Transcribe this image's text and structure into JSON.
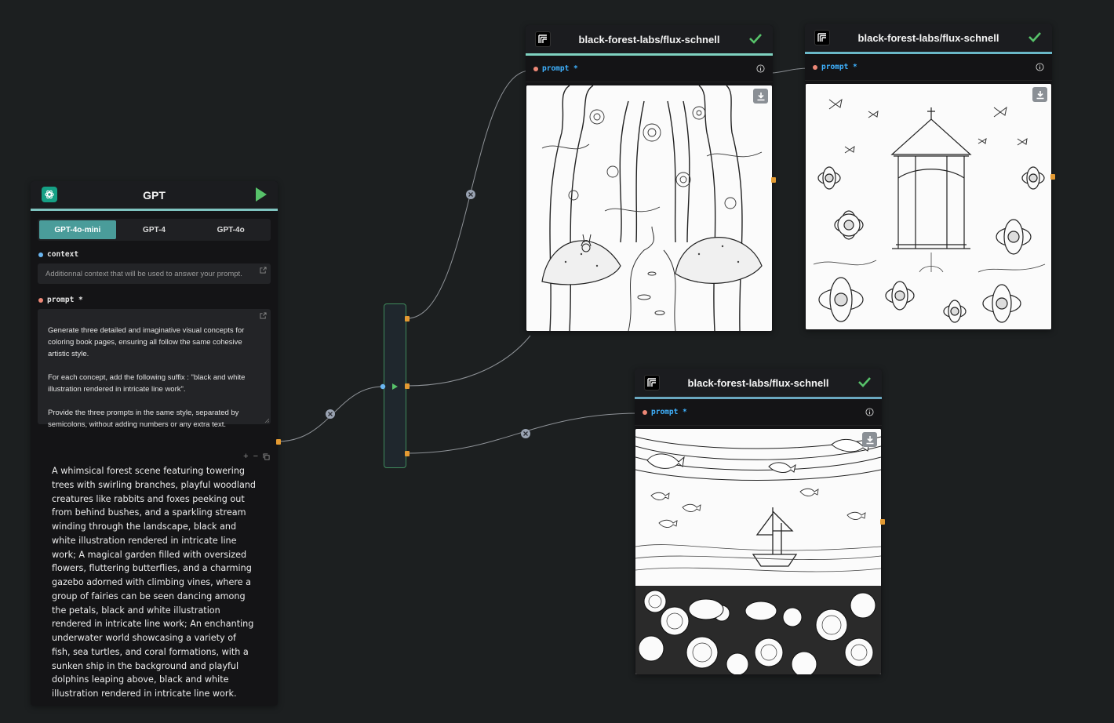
{
  "gpt_node": {
    "title": "GPT",
    "logo_icon": "openai-icon",
    "run_icon": "play-icon",
    "accent_color": "#7fc4c0",
    "models": [
      {
        "label": "GPT-4o-mini",
        "active": true
      },
      {
        "label": "GPT-4",
        "active": false
      },
      {
        "label": "GPT-4o",
        "active": false
      }
    ],
    "context": {
      "label": "context",
      "placeholder": "Additionnal context that will be used to answer your prompt."
    },
    "prompt": {
      "label": "prompt *",
      "value": "Generate three detailed and imaginative visual concepts for coloring book pages, ensuring all follow the same cohesive artistic style.\n\nFor each concept, add the following suffix : \"black and white illustration rendered in intricate line work\".\n\nProvide the three prompts in the same style, separated by semicolons, without adding numbers or any extra text."
    },
    "output_tools": {
      "plus": "+",
      "minus": "−",
      "copy_icon": "copy-icon"
    },
    "output": "A whimsical forest scene featuring towering trees with swirling branches, playful woodland creatures like rabbits and foxes peeking out from behind bushes, and a sparkling stream winding through the landscape, black and white illustration rendered in intricate line work; A magical garden filled with oversized flowers, fluttering butterflies, and a charming gazebo adorned with climbing vines, where a group of fairies can be seen dancing among the petals, black and white illustration rendered in intricate line work; An enchanting underwater world showcasing a variety of fish, sea turtles, and coral formations, with a sunken ship in the background and playful dolphins leaping above, black and white illustration rendered in intricate line work."
  },
  "splitter": {
    "border_color": "#3f8a5c"
  },
  "flux_nodes": [
    {
      "title": "black-forest-labs/flux-schnell",
      "prompt_label": "prompt *",
      "status_icon": "check-icon",
      "accent_color": "#7fd2c0",
      "image_subject": "forest"
    },
    {
      "title": "black-forest-labs/flux-schnell",
      "prompt_label": "prompt *",
      "status_icon": "check-icon",
      "accent_color": "#6ab8c8",
      "image_subject": "garden"
    },
    {
      "title": "black-forest-labs/flux-schnell",
      "prompt_label": "prompt *",
      "status_icon": "check-icon",
      "accent_color": "#6aa8c0",
      "image_subject": "underwater"
    }
  ],
  "colors": {
    "background": "#1c1f20",
    "node": "#141416",
    "port": "#e39a32",
    "success": "#57c26a",
    "prompt_label": "#3fb2ff"
  }
}
